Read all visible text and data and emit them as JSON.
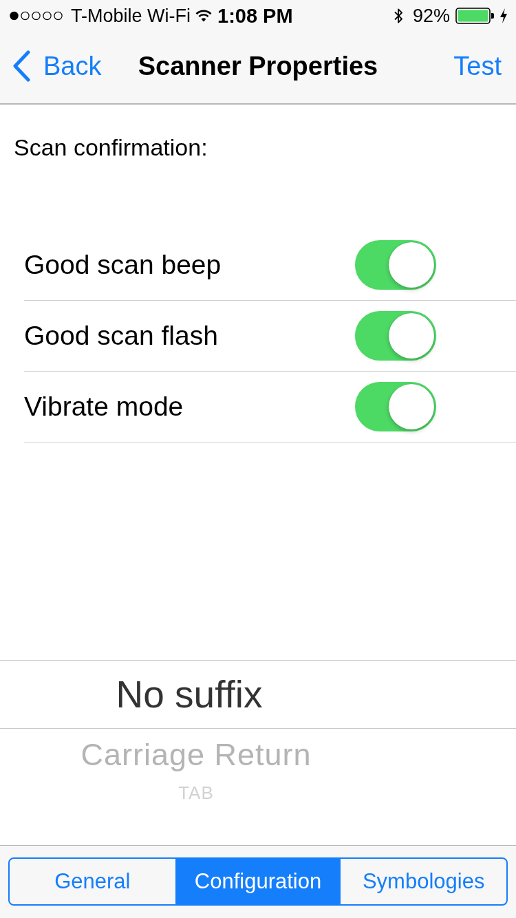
{
  "status_bar": {
    "carrier": "T-Mobile Wi-Fi",
    "time": "1:08 PM",
    "battery": "92%"
  },
  "nav_bar": {
    "back": "Back",
    "title": "Scanner Properties",
    "action": "Test"
  },
  "section_label": "Scan confirmation:",
  "settings": [
    {
      "label": "Good scan beep",
      "on": true
    },
    {
      "label": "Good scan flash",
      "on": true
    },
    {
      "label": "Vibrate mode",
      "on": true
    }
  ],
  "picker": {
    "options": [
      {
        "label": "No suffix",
        "selected": true
      },
      {
        "label": "Carriage Return",
        "selected": false
      },
      {
        "label": "TAB",
        "selected": false
      }
    ]
  },
  "segments": [
    {
      "label": "General",
      "selected": false
    },
    {
      "label": "Configuration",
      "selected": true
    },
    {
      "label": "Symbologies",
      "selected": false
    }
  ]
}
